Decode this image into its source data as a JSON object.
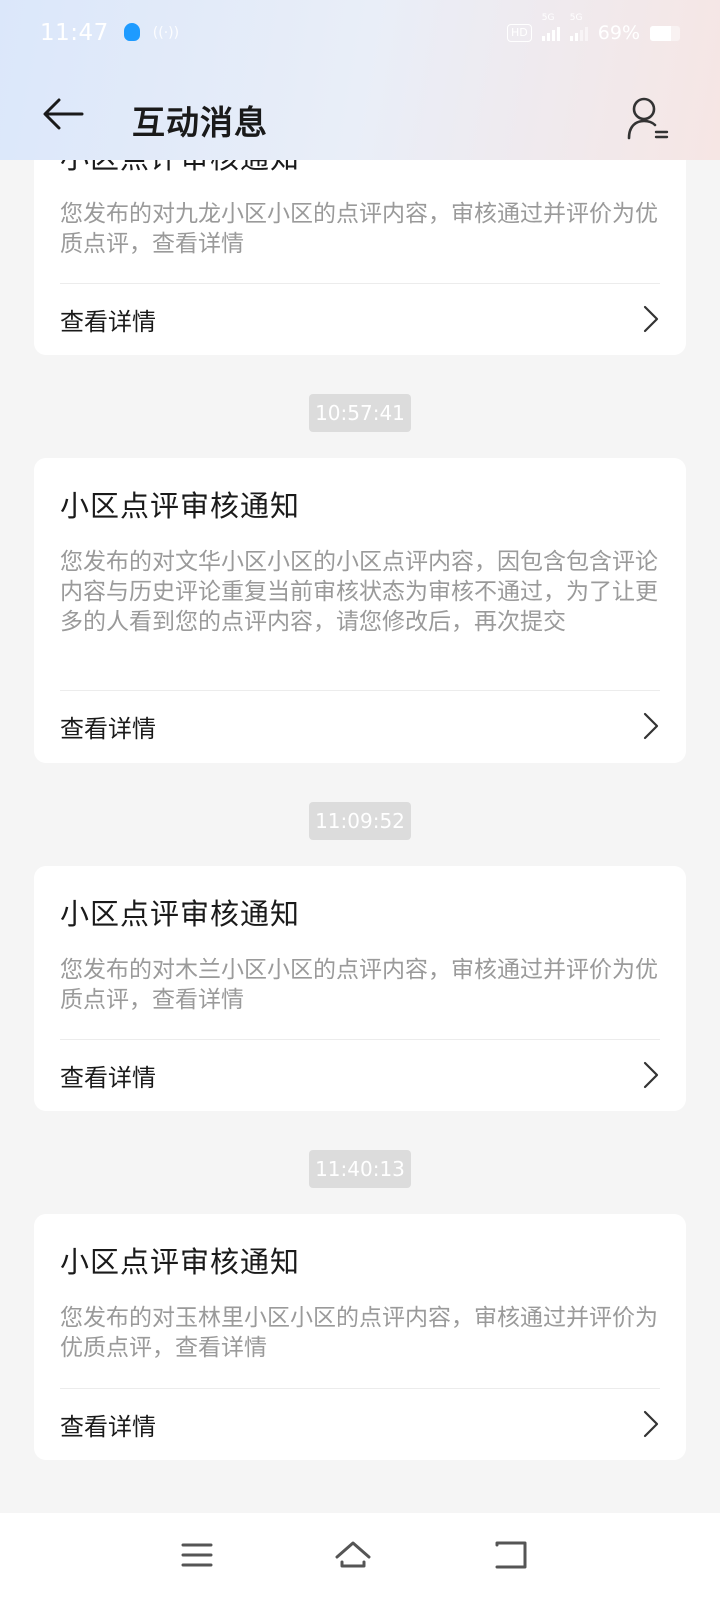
{
  "status_bar": {
    "time": "11:47",
    "hd_label": "HD",
    "signal_1": "5G",
    "signal_2": "5G",
    "battery": "69%",
    "battery_fraction": 0.69
  },
  "header": {
    "title": "互动消息"
  },
  "messages": [
    {
      "title": "小区点评审核通知",
      "body": "您发布的对九龙小区小区的点评内容，审核通过并评价为优质点评，查看详情",
      "link": "查看详情"
    },
    {
      "timestamp": "10:57:41",
      "title": "小区点评审核通知",
      "body": "您发布的对文华小区小区的小区点评内容，因包含包含评论内容与历史评论重复当前审核状态为审核不通过，为了让更多的人看到您的点评内容，请您修改后，再次提交",
      "link": "查看详情"
    },
    {
      "timestamp": "11:09:52",
      "title": "小区点评审核通知",
      "body": "您发布的对木兰小区小区的点评内容，审核通过并评价为优质点评，查看详情",
      "link": "查看详情"
    },
    {
      "timestamp": "11:40:13",
      "title": "小区点评审核通知",
      "body": "您发布的对玉林里小区小区的点评内容，审核通过并评价为优质点评，查看详情",
      "link": "查看详情"
    }
  ]
}
